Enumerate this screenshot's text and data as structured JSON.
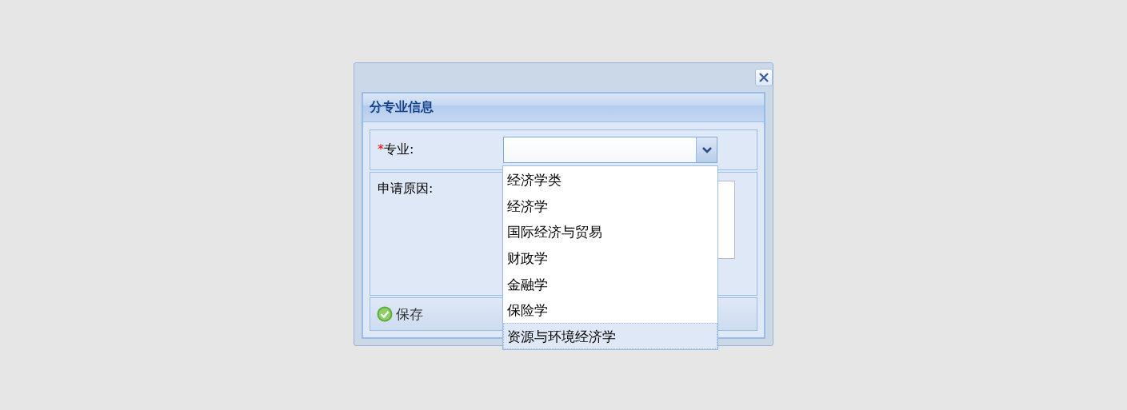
{
  "panel": {
    "title": "分专业信息"
  },
  "fields": [
    {
      "kind": "combo",
      "marker": "*",
      "label": "专业:"
    },
    {
      "kind": "textarea",
      "label": "申请原因:"
    }
  ],
  "toolbar": {
    "buttons": [
      "保存"
    ]
  },
  "dropdown": {
    "options": [
      {
        "label": "经济学类",
        "selected": false
      },
      {
        "label": "经济学",
        "selected": false
      },
      {
        "label": "国际经济与贸易",
        "selected": false
      },
      {
        "label": "财政学",
        "selected": false
      },
      {
        "label": "金融学",
        "selected": false
      },
      {
        "label": "保险学",
        "selected": false
      },
      {
        "label": "资源与环境经济学",
        "selected": true
      }
    ]
  }
}
